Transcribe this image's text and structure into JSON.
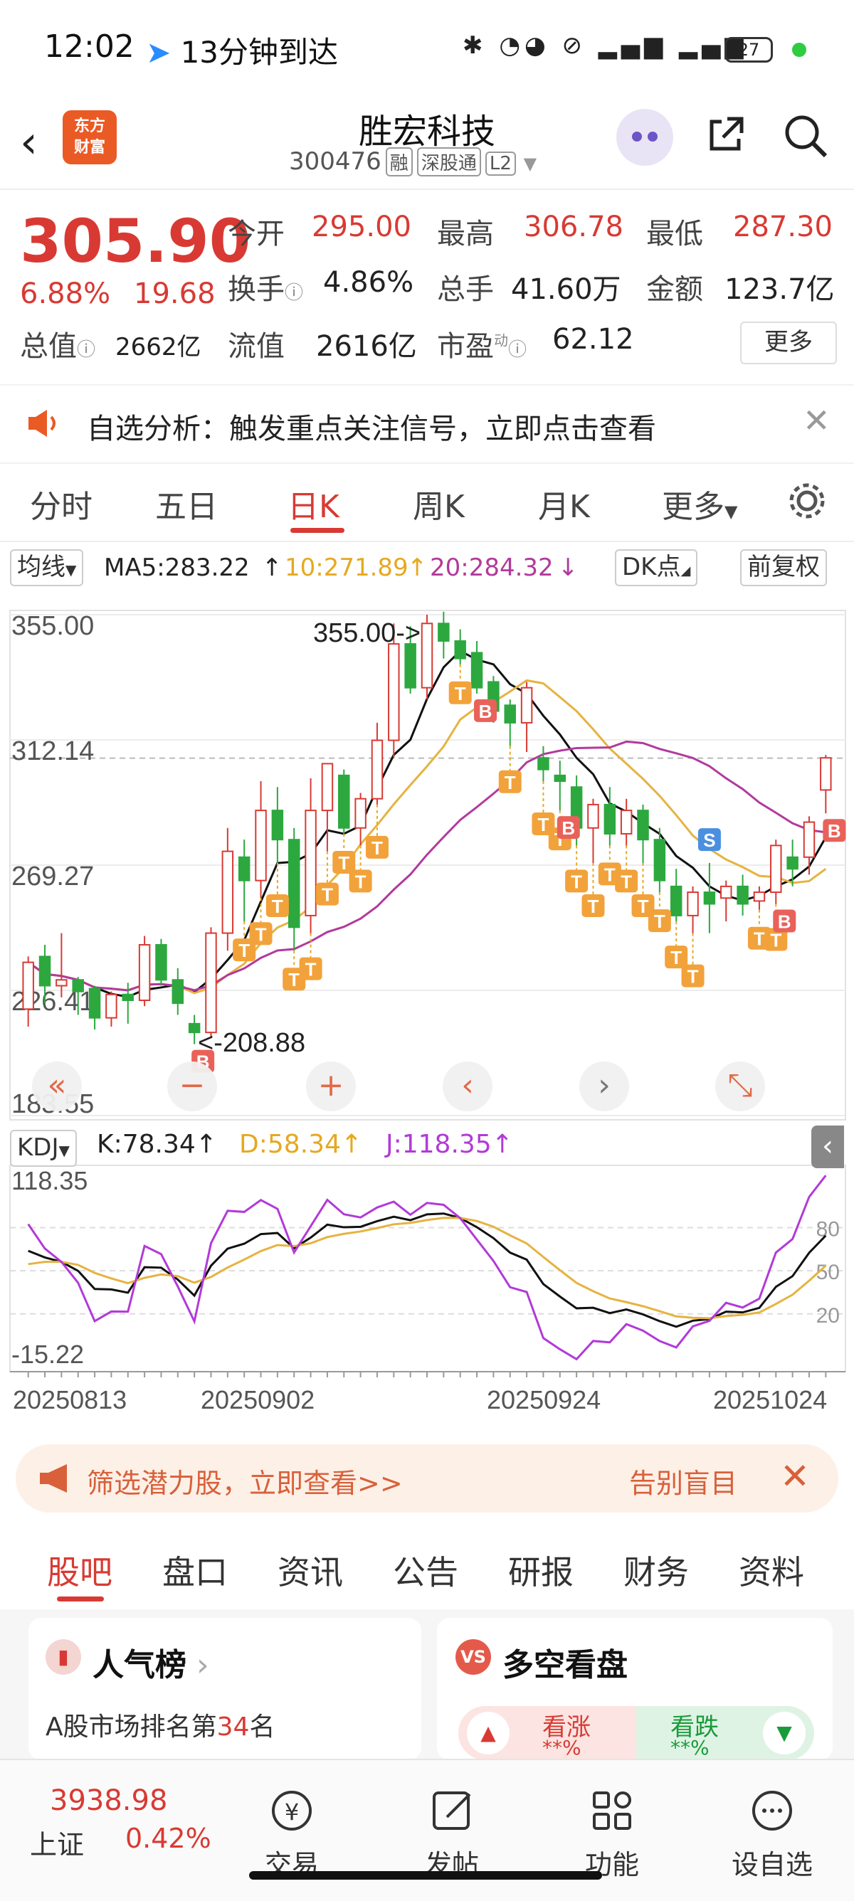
{
  "status_bar": {
    "time": "12:02",
    "delivery_text": "13分钟到达",
    "battery": "27"
  },
  "header": {
    "title": "胜宏科技",
    "code": "300476",
    "tag_rong": "融",
    "tag_connect": "深股通",
    "tag_level": "L2",
    "logo_line1": "东方",
    "logo_line2": "财富"
  },
  "quote": {
    "price": "305.90",
    "change_pct": "6.88%",
    "change_amt": "19.68",
    "open_label": "今开",
    "open": "295.00",
    "high_label": "最高",
    "high": "306.78",
    "low_label": "最低",
    "low": "287.30",
    "turnover_label": "换手",
    "turnover": "4.86%",
    "volume_label": "总手",
    "volume": "41.60万",
    "amount_label": "金额",
    "amount": "123.7亿",
    "mktcap_label": "总值",
    "mktcap": "2662亿",
    "float_label": "流值",
    "float_cap": "2616亿",
    "pe_label": "市盈",
    "pe_sup": "动",
    "pe": "62.12",
    "more_label": "更多"
  },
  "alert": {
    "text": "自选分析：触发重点关注信号，立即点击查看"
  },
  "chart_tabs": [
    "分时",
    "五日",
    "日K",
    "周K",
    "月K",
    "更多"
  ],
  "ma_row": {
    "ma_select": "均线",
    "ma5": "MA5:283.22",
    "ma10": "10:271.89",
    "ma20": "20:284.32",
    "dk": "DK点",
    "adjust": "前复权"
  },
  "kdj_row": {
    "select": "KDJ",
    "k": "K:78.34",
    "d": "D:58.34",
    "j": "J:118.35"
  },
  "chart_data": {
    "type": "candlestick",
    "price_axis_labels": [
      "355.00",
      "312.14",
      "269.27",
      "226.41",
      "183.55"
    ],
    "kdj_axis_labels": [
      "118.35",
      "-15.22"
    ],
    "kdj_right_labels": [
      "80",
      "50",
      "20"
    ],
    "date_labels": [
      "20250813",
      "20250902",
      "20250924",
      "20251024"
    ],
    "annotations": [
      "355.00->",
      "<-208.88"
    ],
    "ylim": [
      183.55,
      355.0
    ],
    "candles": [
      [
        220,
        238,
        214,
        236
      ],
      [
        238,
        242,
        222,
        228
      ],
      [
        228,
        246,
        224,
        230
      ],
      [
        230,
        231,
        218,
        226
      ],
      [
        227,
        228,
        213,
        217
      ],
      [
        217,
        226,
        214,
        225
      ],
      [
        225,
        229,
        215,
        223
      ],
      [
        223,
        245,
        221,
        242
      ],
      [
        242,
        244,
        228,
        230
      ],
      [
        230,
        234,
        218,
        222
      ],
      [
        215,
        218,
        208,
        212
      ],
      [
        212,
        248,
        210,
        246
      ],
      [
        246,
        282,
        240,
        274
      ],
      [
        272,
        278,
        250,
        264
      ],
      [
        264,
        298,
        258,
        288
      ],
      [
        288,
        296,
        270,
        278
      ],
      [
        278,
        282,
        240,
        248
      ],
      [
        252,
        299,
        246,
        288
      ],
      [
        288,
        304,
        274,
        304
      ],
      [
        300,
        302,
        280,
        282
      ],
      [
        282,
        294,
        276,
        292
      ],
      [
        292,
        318,
        290,
        312
      ],
      [
        312,
        352,
        306,
        345
      ],
      [
        345,
        351,
        328,
        330
      ],
      [
        330,
        355,
        326,
        352
      ],
      [
        352,
        356,
        340,
        346
      ],
      [
        346,
        350,
        338,
        340
      ],
      [
        342,
        346,
        328,
        330
      ],
      [
        332,
        334,
        318,
        322
      ],
      [
        324,
        326,
        310,
        318
      ],
      [
        318,
        332,
        308,
        330
      ],
      [
        306,
        310,
        298,
        302
      ],
      [
        300,
        305,
        288,
        298
      ],
      [
        296,
        300,
        276,
        282
      ],
      [
        282,
        292,
        270,
        290
      ],
      [
        290,
        296,
        276,
        280
      ],
      [
        280,
        292,
        276,
        288
      ],
      [
        288,
        290,
        270,
        278
      ],
      [
        278,
        282,
        260,
        264
      ],
      [
        262,
        268,
        250,
        252
      ],
      [
        252,
        262,
        246,
        260
      ],
      [
        260,
        270,
        246,
        256
      ],
      [
        258,
        264,
        250,
        262
      ],
      [
        262,
        266,
        252,
        256
      ],
      [
        257,
        262,
        254,
        260
      ],
      [
        260,
        278,
        256,
        276
      ],
      [
        272,
        278,
        262,
        268
      ],
      [
        272,
        286,
        266,
        284
      ],
      [
        295,
        307,
        287,
        306
      ]
    ]
  },
  "controls": [
    "«",
    "−",
    "+",
    "‹",
    "›",
    "⤡"
  ],
  "ad": {
    "text": "筛选潜力股，立即查看>>",
    "right": "告别盲目"
  },
  "bottom_tabs": [
    "股吧",
    "盘口",
    "资讯",
    "公告",
    "研报",
    "财务",
    "资料"
  ],
  "cards": {
    "popularity": {
      "title": "人气榜",
      "line1": "A股市场排名第",
      "rank": "34",
      "unit": "名"
    },
    "longshort": {
      "title": "多空看盘",
      "up": "看涨",
      "down": "看跌",
      "stars": "**%"
    }
  },
  "bottom_nav": {
    "index_value": "3938.98",
    "index_name": "上证",
    "index_change": "0.42%",
    "items": [
      "交易",
      "发帖",
      "功能",
      "设自选"
    ]
  }
}
